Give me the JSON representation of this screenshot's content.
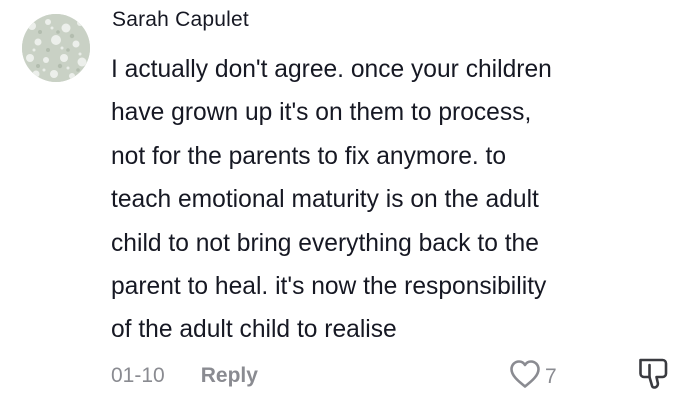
{
  "comment": {
    "author": "Sarah Capulet",
    "text_lines": [
      "I actually don't agree. once your children",
      "have grown up it's on them to process,",
      "not for the parents to fix anymore. to",
      "teach emotional maturity is on the adult",
      "child to not bring everything back to the",
      "parent to heal. it's now the responsibility",
      "of the adult child to realise"
    ],
    "date": "01-10",
    "reply_label": "Reply",
    "like_count": "7",
    "avatar_icon": "floral-pattern-avatar",
    "like_icon": "heart-outline-icon",
    "dislike_icon": "thumbs-down-icon"
  }
}
